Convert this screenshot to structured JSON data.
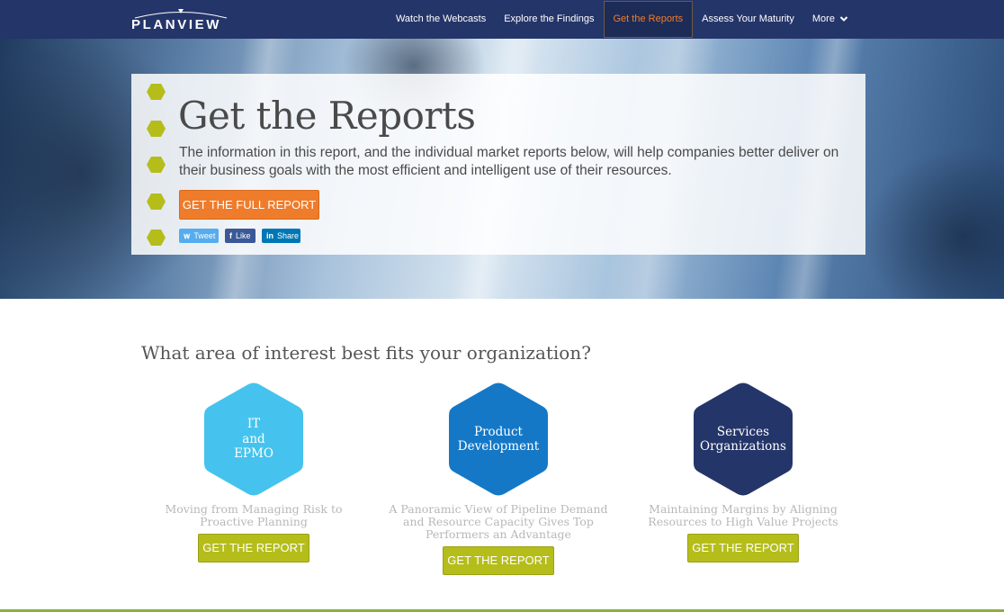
{
  "nav": {
    "logo_text": "PLANVIEW",
    "items": [
      {
        "label": "Watch the Webcasts"
      },
      {
        "label": "Explore the Findings"
      },
      {
        "label": "Get the Reports",
        "active": true
      },
      {
        "label": "Assess Your Maturity"
      },
      {
        "label": "More"
      }
    ]
  },
  "hero": {
    "title": "Get the Reports",
    "description": "The information in this report, and the individual market reports below, will help companies better deliver on their business goals with the most efficient and intelligent use of their resources.",
    "cta_label": "GET THE FULL REPORT",
    "share": {
      "tweet": "Tweet",
      "like": "Like",
      "share": "Share"
    }
  },
  "section": {
    "question": "What area of interest best fits your organization?",
    "cards": [
      {
        "hex_label": "IT\nand\nEPMO",
        "subtitle": "Moving from Managing Risk to Proactive Planning",
        "button": "GET THE REPORT"
      },
      {
        "hex_label": "Product\nDevelopment",
        "subtitle": "A Panoramic View of Pipeline Demand and Resource Capacity Gives Top Performers an Advantage",
        "button": "GET THE REPORT"
      },
      {
        "hex_label": "Services\nOrganizations",
        "subtitle": "Maintaining Margins by Aligning Resources to High Value Projects",
        "button": "GET THE REPORT"
      }
    ]
  },
  "colors": {
    "nav_bg": "#243569",
    "accent_orange": "#ef7c2a",
    "accent_green": "#b5bd1b",
    "hex_light_blue": "#45c3ee",
    "hex_mid_blue": "#1478c7",
    "hex_navy": "#243569"
  }
}
